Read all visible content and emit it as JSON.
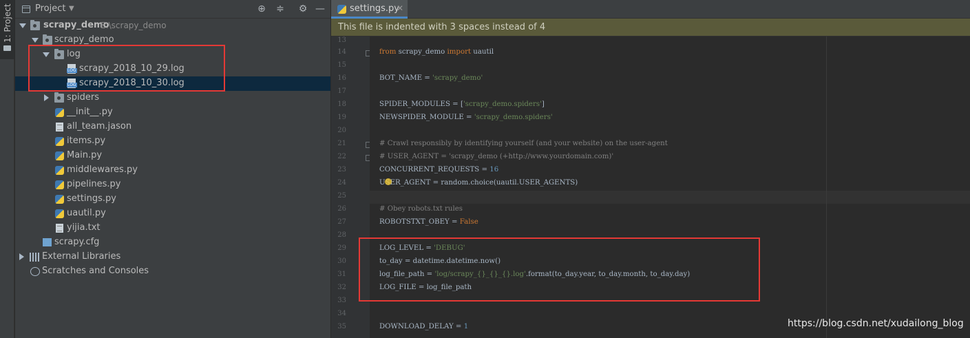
{
  "stripe": {
    "label": "1: Project"
  },
  "project": {
    "title": "Project",
    "tree": [
      {
        "label": "scrapy_demo",
        "path": "E:\\scrapy_demo"
      },
      {
        "label": "scrapy_demo"
      },
      {
        "label": "log"
      },
      {
        "label": "scrapy_2018_10_29.log"
      },
      {
        "label": "scrapy_2018_10_30.log"
      },
      {
        "label": "spiders"
      },
      {
        "label": "__init__.py"
      },
      {
        "label": "all_team.jason"
      },
      {
        "label": "items.py"
      },
      {
        "label": "Main.py"
      },
      {
        "label": "middlewares.py"
      },
      {
        "label": "pipelines.py"
      },
      {
        "label": "settings.py"
      },
      {
        "label": "uautil.py"
      },
      {
        "label": "yijia.txt"
      },
      {
        "label": "scrapy.cfg"
      },
      {
        "label": "External Libraries"
      },
      {
        "label": "Scratches and Consoles"
      }
    ]
  },
  "editor": {
    "tab_label": "settings.py",
    "banner": "This file is indented with 3 spaces instead of 4",
    "line_numbers": [
      "13",
      "14",
      "15",
      "16",
      "17",
      "18",
      "19",
      "20",
      "21",
      "22",
      "23",
      "24",
      "25",
      "26",
      "27",
      "28",
      "29",
      "30",
      "31",
      "32",
      "33",
      "34",
      "35"
    ],
    "code": {
      "l14a": "from",
      "l14b": " scrapy_demo ",
      "l14c": "import",
      "l14d": " uautil",
      "l16a": "BOT_NAME = ",
      "l16b": "'scrapy_demo'",
      "l18a": "SPIDER_MODULES = [",
      "l18b": "'scrapy_demo.spiders'",
      "l18c": "]",
      "l19a": "NEWSPIDER_MODULE = ",
      "l19b": "'scrapy_demo.spiders'",
      "l21": "# Crawl responsibly by identifying yourself (and your website) on the user-agent",
      "l22": "# USER_AGENT = 'scrapy_demo (+http://www.yourdomain.com)'",
      "l23a": "CONCURRENT_REQUESTS = ",
      "l23b": "16",
      "l24": "USER_AGENT = random.choice(uautil.USER_AGENTS)",
      "l26": "# Obey robots.txt rules",
      "l27a": "ROBOTSTXT_OBEY = ",
      "l27b": "False",
      "l29a": "LOG_LEVEL = ",
      "l29b": "'DEBUG'",
      "l30": "to_day = datetime.datetime.now()",
      "l31a": "log_file_path = ",
      "l31b": "'log/scrapy_{}_{}_{}.log'",
      "l31c": ".format(to_day.year, to_day.month, to_day.day)",
      "l32": "LOG_FILE = log_file_path",
      "l35a": "DOWNLOAD_DELAY = ",
      "l35b": "1"
    }
  },
  "watermark": "https://blog.csdn.net/xudailong_blog",
  "colors": {
    "highlight_box": "#e53935",
    "selection": "#0d293e",
    "banner": "#5a5a3a"
  }
}
